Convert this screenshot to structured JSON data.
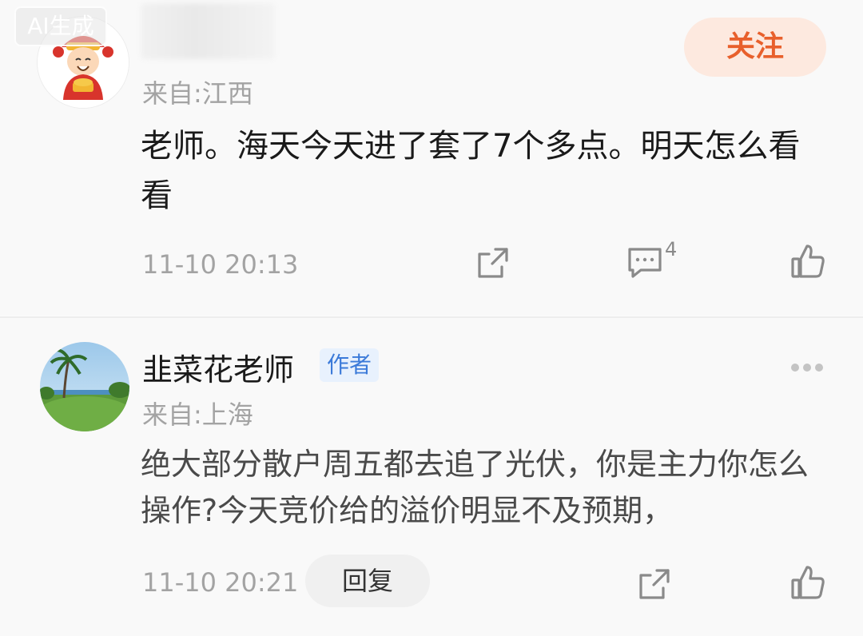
{
  "badge": {
    "label": "AI生成"
  },
  "comment_1": {
    "avatar_icon": "god-of-wealth-avatar",
    "follow_label": "关注",
    "location": "来自:江西",
    "text": "老师。海天今天进了套了7个多点。明天怎么看看",
    "timestamp": "11-10 20:13",
    "reply_count": "4",
    "icons": [
      "share-icon",
      "comment-icon",
      "thumbs-up-icon"
    ]
  },
  "comment_2": {
    "avatar_icon": "palm-tree-lawn-avatar",
    "name": "韭菜花老师",
    "author_tag": "作者",
    "location": "来自:上海",
    "text": "绝大部分散户周五都去追了光伏，你是主力你怎么操作?今天竞价给的溢价明显不及预期，",
    "timestamp": "11-10 20:21",
    "reply_label": "回复",
    "icons": [
      "more-icon",
      "share-icon",
      "thumbs-up-icon"
    ]
  },
  "colors": {
    "accent": "#e8602c",
    "follow_bg": "#fde9df",
    "author_tag_bg": "#e8f1fd",
    "author_tag_text": "#3b7ad9",
    "meta_text": "#a3a3a3"
  }
}
